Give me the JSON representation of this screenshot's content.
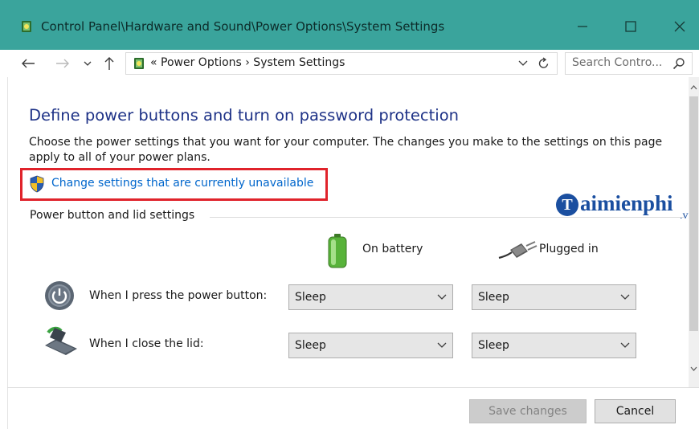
{
  "window": {
    "title": "Control Panel\\Hardware and Sound\\Power Options\\System Settings",
    "title_bar_color": "#3aa49c"
  },
  "address_bar": {
    "path_text": "«  Power Options  ›  System Settings",
    "search_placeholder": "Search Contro..."
  },
  "main": {
    "heading": "Define power buttons and turn on password protection",
    "description": "Choose the power settings that you want for your computer. The changes you make to the settings on this page apply to all of your power plans.",
    "change_settings_link": "Change settings that are currently unavailable",
    "section_label": "Power button and lid settings",
    "columns": {
      "on_battery": "On battery",
      "plugged_in": "Plugged in"
    },
    "rows": [
      {
        "label": "When I press the power button:",
        "on_battery": "Sleep",
        "plugged_in": "Sleep"
      },
      {
        "label": "When I close the lid:",
        "on_battery": "Sleep",
        "plugged_in": "Sleep"
      }
    ]
  },
  "footer": {
    "save_label": "Save changes",
    "cancel_label": "Cancel"
  },
  "watermark": {
    "brand_letter": "T",
    "brand_name": "aimienphi",
    "brand_suffix": ".vn"
  },
  "colors": {
    "heading": "#1e3287",
    "link": "#0066cc",
    "highlight_border": "#e0232b"
  }
}
